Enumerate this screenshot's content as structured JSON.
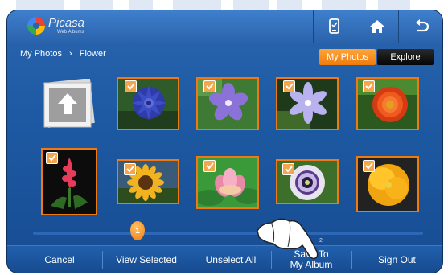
{
  "app": {
    "logo_name": "Picasa",
    "logo_sub": "Web Albums"
  },
  "topbar": {
    "icons": [
      "phone-hand-icon",
      "home-icon",
      "back-arrow-icon"
    ]
  },
  "breadcrumb": {
    "root": "My Photos",
    "separator": "›",
    "current": "Flower"
  },
  "tabs": {
    "my_photos": "My Photos",
    "explore": "Explore"
  },
  "grid": {
    "up_folder_icon": "up-arrow-icon",
    "photos": [
      {
        "name": "blue-cornflower",
        "checked": true
      },
      {
        "name": "purple-periwinkle",
        "checked": true
      },
      {
        "name": "lavender-anemone",
        "checked": true
      },
      {
        "name": "orange-zinnia",
        "checked": true
      },
      {
        "name": "red-ginger-lily",
        "checked": true
      },
      {
        "name": "sunflower",
        "checked": true
      },
      {
        "name": "pink-lotus",
        "checked": true
      },
      {
        "name": "passion-flower",
        "checked": true
      },
      {
        "name": "yellow-poppy",
        "checked": true
      }
    ]
  },
  "pagination": {
    "current": "1",
    "total": "2"
  },
  "bottom": {
    "cancel": "Cancel",
    "view_selected": "View Selected",
    "unselect_all": "Unselect All",
    "save_line1": "Save To",
    "save_line2": "My Album",
    "sign_out": "Sign Out"
  },
  "colors": {
    "accent": "#f07a12",
    "background": "#1d5aa3",
    "tab_active": "#ef7a0c"
  }
}
